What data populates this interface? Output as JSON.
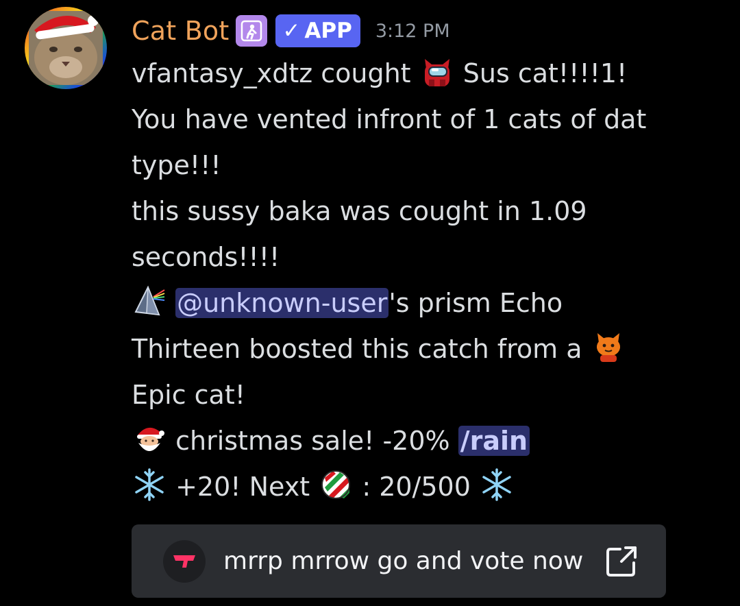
{
  "author": {
    "username": "Cat Bot",
    "badge": "APP",
    "badge_check": "✓",
    "timestamp": "3:12 PM",
    "avatar_icon": "cat-santa-avatar",
    "role_icon": "kneeling-person-icon"
  },
  "message": {
    "line1_user": "vfantasy_xdtz cought",
    "line1_cat": "Sus cat!!!!1!",
    "line2": "You have vented infront of 1 cats of dat",
    "line3": "type!!!",
    "line4": "this sussy baka was cought in 1.09",
    "line5": "seconds!!!!",
    "line6_mention": "@unknown-user",
    "line6_rest": "'s prism Echo",
    "line7": "Thirteen boosted this catch from a",
    "line8": "Epic cat!",
    "line9_text": "christmas sale! -20%",
    "line9_command": "/rain",
    "line10_text": "+20! Next",
    "line10_progress": ": 20/500"
  },
  "button": {
    "label": "mrrp mrrow go and vote now"
  },
  "colors": {
    "background": "#000000",
    "username": "#f0a35b",
    "app_badge": "#5865f2",
    "mention_bg": "#2b2f6b",
    "button_bg": "#2b2d31"
  }
}
